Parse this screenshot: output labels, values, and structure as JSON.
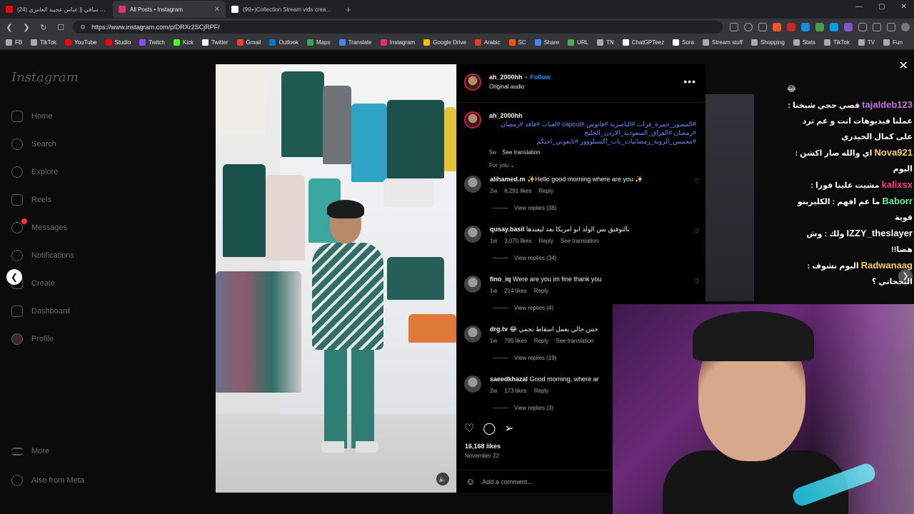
{
  "browser": {
    "tabs": [
      {
        "title": "(24) احمل ساقي || عباس عجيبد العامري",
        "active": false,
        "favicon_color": "#ff0000"
      },
      {
        "title": "All Posts • Instagram",
        "active": true,
        "favicon_color": "#e1306c"
      },
      {
        "title": "(99+)Collection Stream vids created",
        "active": false,
        "favicon_color": "#ffffff"
      }
    ],
    "new_tab": "+",
    "url": "https://www.instagram.com/p/DRXr2SCjRPF/",
    "bookmarks": [
      {
        "label": "FB",
        "color": "#aaaaaa"
      },
      {
        "label": "TikTok",
        "color": "#aaaaaa"
      },
      {
        "label": "YouTube",
        "color": "#ff0000"
      },
      {
        "label": "Studio",
        "color": "#ff0000"
      },
      {
        "label": "Twitch",
        "color": "#9146ff"
      },
      {
        "label": "Kick",
        "color": "#53fc18"
      },
      {
        "label": "Twitter",
        "color": "#ffffff"
      },
      {
        "label": "Gmail",
        "color": "#ea4335"
      },
      {
        "label": "Outlook",
        "color": "#0078d4"
      },
      {
        "label": "Maps",
        "color": "#34a853"
      },
      {
        "label": "Translate",
        "color": "#4285f4"
      },
      {
        "label": "Instagram",
        "color": "#e1306c"
      },
      {
        "label": "Google Drive",
        "color": "#fbbc04"
      },
      {
        "label": "Arabic",
        "color": "#e53935"
      },
      {
        "label": "SC",
        "color": "#ff5500"
      },
      {
        "label": "Share",
        "color": "#4285f4"
      },
      {
        "label": "URL",
        "color": "#4caf50"
      },
      {
        "label": "TN",
        "color": "#aaaaaa"
      },
      {
        "label": "ChatGPTeez",
        "color": "#ffffff"
      },
      {
        "label": "Sora",
        "color": "#ffffff"
      },
      {
        "label": "Stream stuff",
        "color": "#aaaaaa"
      },
      {
        "label": "Shopping",
        "color": "#aaaaaa"
      },
      {
        "label": "Stats",
        "color": "#aaaaaa"
      },
      {
        "label": "TikTok",
        "color": "#aaaaaa"
      },
      {
        "label": "TV",
        "color": "#aaaaaa"
      },
      {
        "label": "Fun",
        "color": "#aaaaaa"
      }
    ]
  },
  "sidebar": {
    "logo": "Instagram",
    "items": [
      {
        "label": "Home",
        "icon": "home-icon"
      },
      {
        "label": "Search",
        "icon": "search-icon"
      },
      {
        "label": "Explore",
        "icon": "compass-icon"
      },
      {
        "label": "Reels",
        "icon": "reels-icon"
      },
      {
        "label": "Messages",
        "icon": "messenger-icon"
      },
      {
        "label": "Notifications",
        "icon": "heart-icon"
      },
      {
        "label": "Create",
        "icon": "plus-square-icon"
      },
      {
        "label": "Dashboard",
        "icon": "dashboard-icon"
      },
      {
        "label": "Profile",
        "icon": "avatar-icon"
      }
    ],
    "bottom": [
      {
        "label": "More",
        "icon": "hamburger-icon"
      },
      {
        "label": "Also from Meta",
        "icon": "meta-icon"
      }
    ]
  },
  "post": {
    "author": "ah_2000hh",
    "follow": "Follow",
    "audio": "Original audio",
    "caption_user": "ah_2000hh",
    "caption_text": "#المصور_حمزة_فرات #الناصرية #فانوس #capcut #لعبات #فاقد #رمضان #رمضان #العراق_السعودية_الاردن_الخليج #محيبس_الزوية_رمضانيات_بات_اكسبلووور #تابعوني_احبكم",
    "caption_age": "5w",
    "see_translation": "See translation",
    "sort_label": "For you",
    "comments": [
      {
        "user": "alihamed.m",
        "text": "✨Hello good morning where are you ✨",
        "age": "2w",
        "likes": "6,291 likes",
        "reply": "Reply",
        "translate": "",
        "replies": "View replies (38)"
      },
      {
        "user": "qusay.basil",
        "text": "بالتوفيق بس الولد ابو امريكا بعد ليعبدها",
        "age": "1w",
        "likes": "3,070 likes",
        "reply": "Reply",
        "translate": "See translation",
        "replies": "View replies (34)"
      },
      {
        "user": "fino_iq",
        "text": "Were are you im fine thank you",
        "age": "1w",
        "likes": "214 likes",
        "reply": "Reply",
        "translate": "",
        "replies": "View replies (4)"
      },
      {
        "user": "drg.tv",
        "text": "😂 حس حالي يعمل اسقاط نجمي",
        "age": "1w",
        "likes": "795 likes",
        "reply": "Reply",
        "translate": "See translation",
        "replies": "View replies (19)"
      },
      {
        "user": "saeedkhazal",
        "text": "Good morning, where ar",
        "age": "2w",
        "likes": "173 likes",
        "reply": "Reply",
        "translate": "",
        "replies": "View replies (3)"
      }
    ],
    "likes": "16,168 likes",
    "date": "November 22",
    "add_comment": "Add a comment..."
  },
  "chat": [
    {
      "user": "tajaldeb123",
      "color": "#c678dd",
      "msg": "قصي حجي شيخنا : عملنا فيديوهات انت و عم ترد على كمال الحيدري"
    },
    {
      "user": "Nova921",
      "color": "#ffd54f",
      "msg": "اي والله صار اكشن : اليوم"
    },
    {
      "user": "kalixsx",
      "color": "#ff4081",
      "msg": "مشيت علينا فورا :"
    },
    {
      "user": "Baborr",
      "color": "#69f0ae",
      "msg": "ما عم افهم : الكليزيتو قوية"
    },
    {
      "user": "IZZY_theslayer",
      "color": "#ffffff",
      "msg": "ولك : وش هضا!!"
    },
    {
      "user": "Radwanaag",
      "color": "#ffd54f",
      "msg": "اليوم نشوف : البجحاتي ؟"
    }
  ]
}
